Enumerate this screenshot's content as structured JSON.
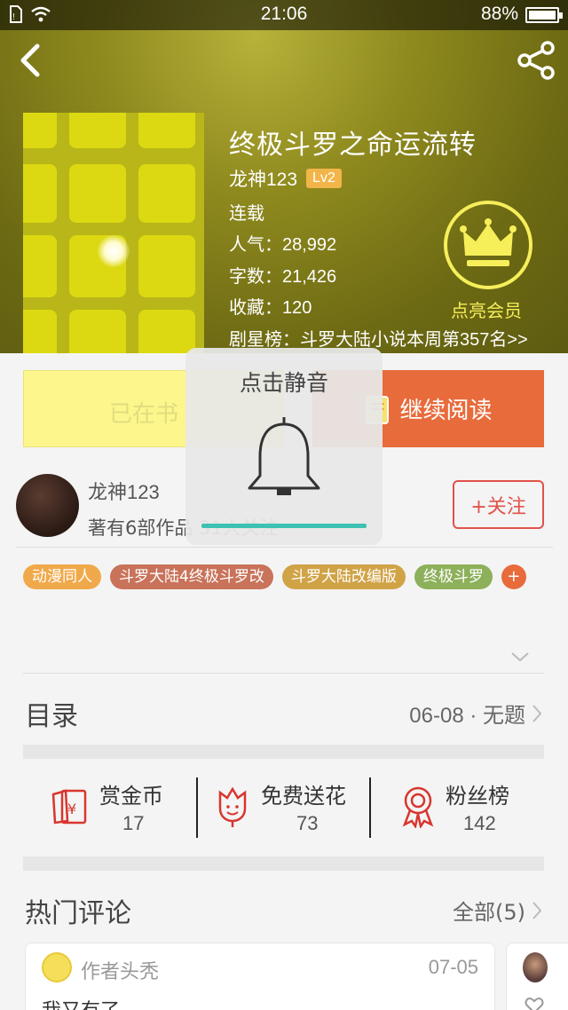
{
  "status_bar": {
    "time": "21:06",
    "battery": "88%",
    "battery_level": 0.88
  },
  "book": {
    "title": "终极斗罗之命运流转",
    "author": "龙神123",
    "level": "Lv2",
    "status": "连载",
    "popularity": "人气：28,992",
    "word_count": "字数：21,426",
    "favorites": "收藏：120",
    "ranking": "剧星榜：斗罗大陆小说本周第357名>>"
  },
  "vip": {
    "label": "点亮会员"
  },
  "actions": {
    "shelf_label": "已在书",
    "read_label": "继续阅读"
  },
  "mute_popup": {
    "title": "点击静音"
  },
  "author_row": {
    "name": "龙神123",
    "info": "著有6部作品 31人关注",
    "follow_label": "+关注"
  },
  "tags": [
    {
      "label": "动漫同人",
      "color": "#f0a94a"
    },
    {
      "label": "斗罗大陆4终极斗罗改",
      "color": "#c8735a"
    },
    {
      "label": "斗罗大陆改编版",
      "color": "#d0a347"
    },
    {
      "label": "终极斗罗",
      "color": "#8db05a"
    }
  ],
  "tag_add_label": "+",
  "catalog": {
    "title": "目录",
    "latest": "06-08 · 无题"
  },
  "stats": [
    {
      "label": "赏金币",
      "value": "17",
      "icon": "red-envelope-icon"
    },
    {
      "label": "免费送花",
      "value": "73",
      "icon": "flower-icon"
    },
    {
      "label": "粉丝榜",
      "value": "142",
      "icon": "medal-icon"
    }
  ],
  "comments": {
    "title": "热门评论",
    "all_label": "全部(5)",
    "items": [
      {
        "user": "作者头秃",
        "date": "07-05",
        "text": "我又有了"
      }
    ]
  },
  "colors": {
    "accent": "#e86b3c",
    "follow": "#e0534a",
    "vip": "#f6ef5a",
    "progress": "#3cc1b2"
  }
}
